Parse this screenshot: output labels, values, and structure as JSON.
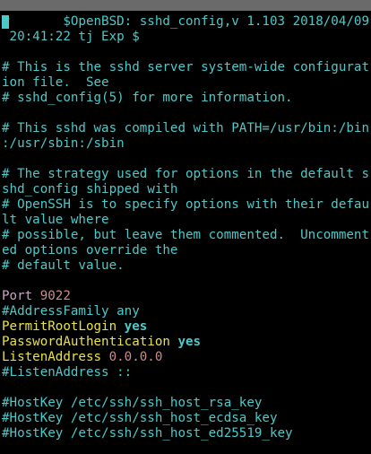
{
  "terminal": {
    "lines": [
      {
        "type": "comment",
        "text": "#       $OpenBSD: sshd_config,v 1.103 2018/04/09"
      },
      {
        "type": "comment",
        "text": " 20:41:22 tj Exp $"
      },
      {
        "type": "blank",
        "text": ""
      },
      {
        "type": "comment",
        "text": "# This is the sshd server system-wide configurat"
      },
      {
        "type": "comment",
        "text": "ion file.  See"
      },
      {
        "type": "comment",
        "text": "# sshd_config(5) for more information."
      },
      {
        "type": "blank",
        "text": ""
      },
      {
        "type": "comment",
        "text": "# This sshd was compiled with PATH=/usr/bin:/bin"
      },
      {
        "type": "comment",
        "text": ":/usr/sbin:/sbin"
      },
      {
        "type": "blank",
        "text": ""
      },
      {
        "type": "comment",
        "text": "# The strategy used for options in the default s"
      },
      {
        "type": "comment",
        "text": "shd_config shipped with"
      },
      {
        "type": "comment",
        "text": "# OpenSSH is to specify options with their defau"
      },
      {
        "type": "comment",
        "text": "lt value where"
      },
      {
        "type": "comment",
        "text": "# possible, but leave them commented.  Uncomment"
      },
      {
        "type": "comment",
        "text": "ed options override the"
      },
      {
        "type": "comment",
        "text": "# default value."
      },
      {
        "type": "blank",
        "text": ""
      },
      {
        "type": "setting",
        "key": "Port",
        "sep": " ",
        "value": "9022",
        "valueStyle": "num",
        "keyStyle": "port"
      },
      {
        "type": "comment",
        "text": "#AddressFamily any"
      },
      {
        "type": "setting",
        "key": "PermitRootLogin",
        "sep": " ",
        "value": "yes",
        "valueStyle": "bold",
        "keyStyle": "key"
      },
      {
        "type": "setting",
        "key": "PasswordAuthentication",
        "sep": " ",
        "value": "yes",
        "valueStyle": "bold",
        "keyStyle": "key"
      },
      {
        "type": "setting",
        "key": "ListenAddress",
        "sep": " ",
        "value": "0.0.0.0",
        "valueStyle": "num",
        "keyStyle": "key"
      },
      {
        "type": "comment",
        "text": "#ListenAddress ::"
      },
      {
        "type": "blank",
        "text": ""
      },
      {
        "type": "comment",
        "text": "#HostKey /etc/ssh/ssh_host_rsa_key"
      },
      {
        "type": "comment",
        "text": "#HostKey /etc/ssh/ssh_host_ecdsa_key"
      },
      {
        "type": "comment",
        "text": "#HostKey /etc/ssh/ssh_host_ed25519_key"
      }
    ]
  },
  "colors": {
    "background": "#000000",
    "comment": "#4ec9c9",
    "keyword": "#e9e14a",
    "number": "#c98d8d",
    "cursor": "#4ec9c9",
    "title_strip": "#6a6a6a"
  }
}
